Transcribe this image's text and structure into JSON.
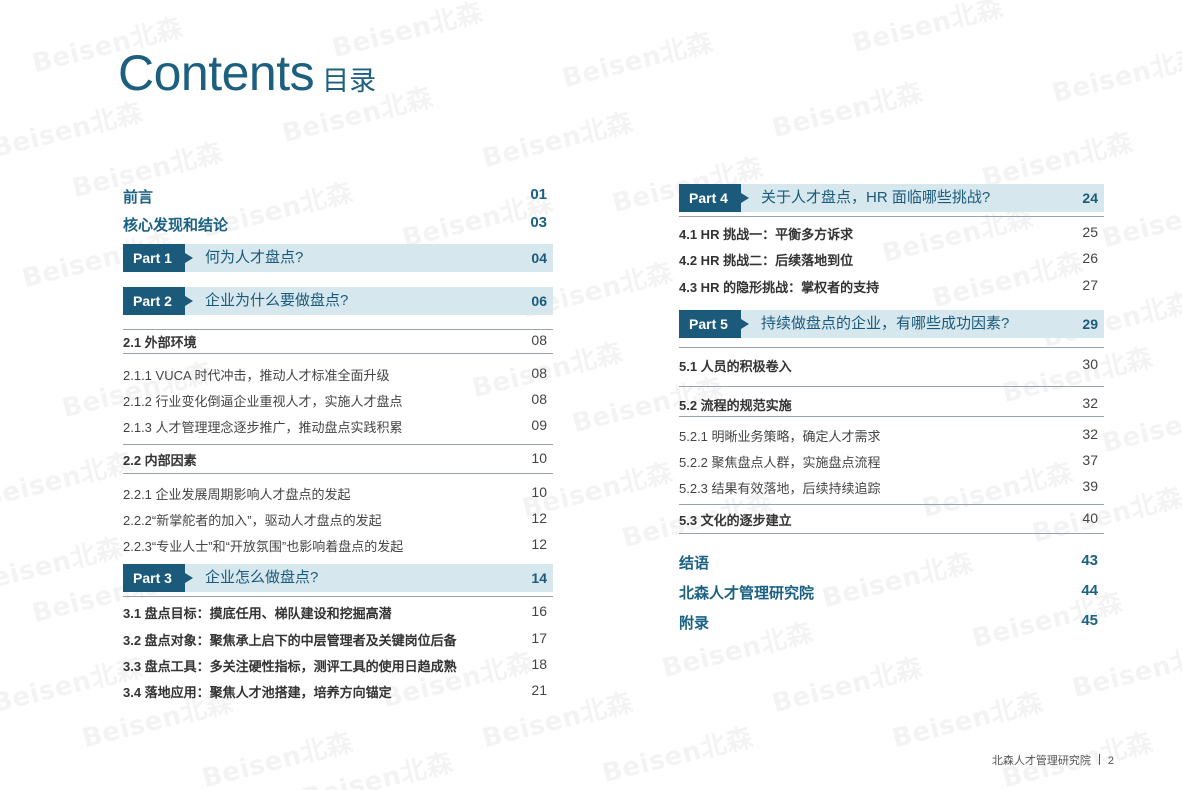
{
  "title": {
    "en": "Contents",
    "cn": "目录"
  },
  "watermark": "Beisen北森",
  "left": {
    "preface": {
      "label": "前言",
      "page": "01"
    },
    "findings": {
      "label": "核心发现和结论",
      "page": "03"
    },
    "part1": {
      "tag": "Part 1",
      "title": "何为人才盘点?",
      "page": "04"
    },
    "part2": {
      "tag": "Part 2",
      "title": "企业为什么要做盘点?",
      "page": "06"
    },
    "s21": {
      "label": "2.1  外部环境",
      "page": "08"
    },
    "s211": {
      "label": "2.1.1 VUCA 时代冲击，推动人才标准全面升级",
      "page": "08"
    },
    "s212": {
      "label": "2.1.2 行业变化倒逼企业重视人才，实施人才盘点",
      "page": "08"
    },
    "s213": {
      "label": "2.1.3 人才管理理念逐步推广，推动盘点实践积累",
      "page": "09"
    },
    "s22": {
      "label": "2.2  内部因素",
      "page": "10"
    },
    "s221": {
      "label": "2.2.1 企业发展周期影响人才盘点的发起",
      "page": "10"
    },
    "s222": {
      "label": "2.2.2“新掌舵者的加入”，驱动人才盘点的发起",
      "page": "12"
    },
    "s223": {
      "label": "2.2.3“专业人士”和“开放氛围”也影响着盘点的发起",
      "page": "12"
    },
    "part3": {
      "tag": "Part 3",
      "title": "企业怎么做盘点?",
      "page": "14"
    },
    "s31": {
      "label": "3.1  盘点目标：摸底任用、梯队建设和挖掘高潜",
      "page": "16"
    },
    "s32": {
      "label": "3.2  盘点对象：聚焦承上启下的中层管理者及关键岗位后备",
      "page": "17"
    },
    "s33": {
      "label": "3.3  盘点工具：多关注硬性指标，测评工具的使用日趋成熟",
      "page": "18"
    },
    "s34": {
      "label": "3.4  落地应用：聚焦人才池搭建，培养方向锚定",
      "page": "21"
    }
  },
  "right": {
    "part4": {
      "tag": "Part 4",
      "title": "关于人才盘点，HR 面临哪些挑战?",
      "page": "24"
    },
    "s41": {
      "label": "4.1 HR 挑战一：平衡多方诉求",
      "page": "25"
    },
    "s42": {
      "label": "4.2 HR 挑战二：后续落地到位",
      "page": "26"
    },
    "s43": {
      "label": "4.3 HR 的隐形挑战：掌权者的支持",
      "page": "27"
    },
    "part5": {
      "tag": "Part 5",
      "title": "持续做盘点的企业，有哪些成功因素?",
      "page": "29"
    },
    "s51": {
      "label": "5.1  人员的积极卷入",
      "page": "30"
    },
    "s52": {
      "label": "5.2  流程的规范实施",
      "page": "32"
    },
    "s521": {
      "label": "5.2.1 明晰业务策略，确定人才需求",
      "page": "32"
    },
    "s522": {
      "label": "5.2.2 聚焦盘点人群，实施盘点流程",
      "page": "37"
    },
    "s523": {
      "label": "5.2.3 结果有效落地，后续持续追踪",
      "page": "39"
    },
    "s53": {
      "label": "5.3  文化的逐步建立",
      "page": "40"
    },
    "conclusion": {
      "label": "结语",
      "page": "43"
    },
    "institute": {
      "label": "北森人才管理研究院",
      "page": "44"
    },
    "appendix": {
      "label": "附录",
      "page": "45"
    }
  },
  "footer": {
    "org": "北森人才管理研究院",
    "page": "2"
  },
  "colors": {
    "accent": "#1b5a7a",
    "band": "#d6e7ee",
    "title": "#1c5f7e"
  }
}
